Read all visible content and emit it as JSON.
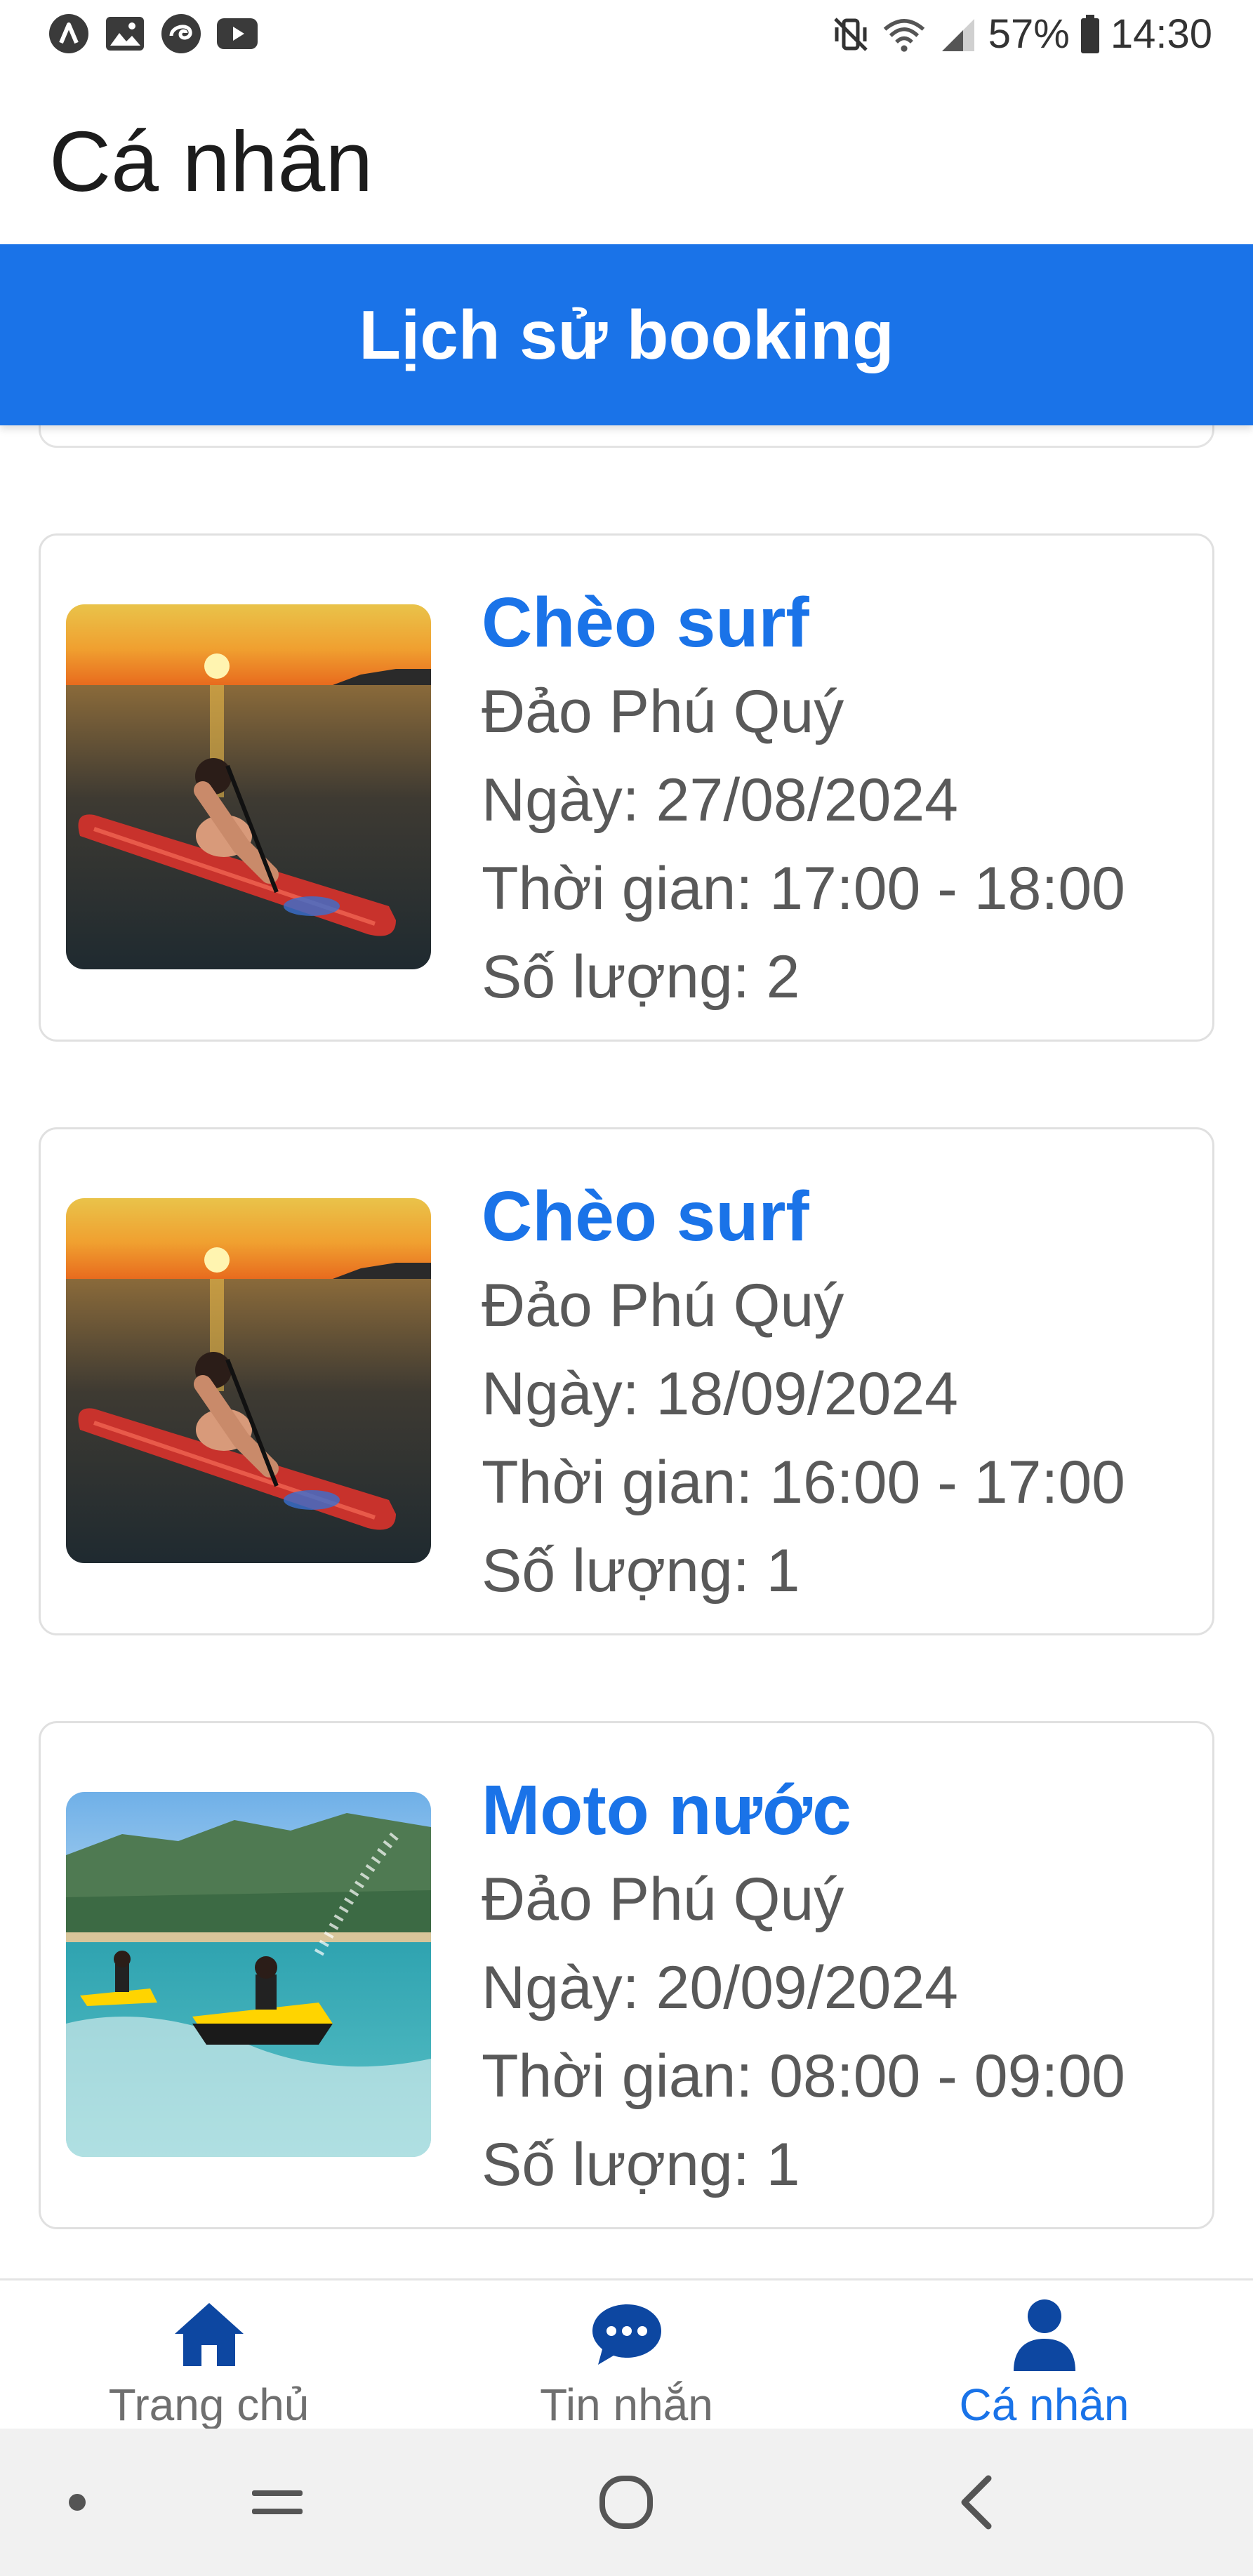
{
  "status_bar": {
    "battery": "57%",
    "time": "14:30",
    "left_icons": [
      "a-logo-icon",
      "gallery-icon",
      "swirl-app-icon",
      "youtube-icon"
    ],
    "right_icons": [
      "mute-vibrate-icon",
      "wifi-icon",
      "signal-icon",
      "battery-icon"
    ]
  },
  "header": {
    "title": "Cá nhân"
  },
  "section": {
    "title": "Lịch sử booking"
  },
  "bookings": [
    {
      "title": "Chèo surf",
      "location": "Đảo Phú Quý",
      "date": "Ngày: 27/08/2024",
      "time": "Thời gian: 17:00 - 18:00",
      "quantity": "Số lượng: 2",
      "thumbnail": "sunset-paddleboard-photo"
    },
    {
      "title": "Chèo surf",
      "location": "Đảo Phú Quý",
      "date": "Ngày: 18/09/2024",
      "time": "Thời gian: 16:00 - 17:00",
      "quantity": "Số lượng: 1",
      "thumbnail": "sunset-paddleboard-photo"
    },
    {
      "title": "Moto nước",
      "location": "Đảo Phú Quý",
      "date": "Ngày: 20/09/2024",
      "time": "Thời gian: 08:00 - 09:00",
      "quantity": "Số lượng: 1",
      "thumbnail": "jetski-photo"
    }
  ],
  "bottom_nav": {
    "items": [
      {
        "label": "Trang chủ",
        "icon": "home-icon",
        "active": false
      },
      {
        "label": "Tin nhắn",
        "icon": "chat-bubble-icon",
        "active": false
      },
      {
        "label": "Cá nhân",
        "icon": "person-icon",
        "active": true
      }
    ]
  },
  "colors": {
    "accent": "#1a73e8",
    "nav_inactive": "#6f6f6f",
    "icon_dark_blue": "#0d47a1",
    "text_secondary": "#595959"
  }
}
